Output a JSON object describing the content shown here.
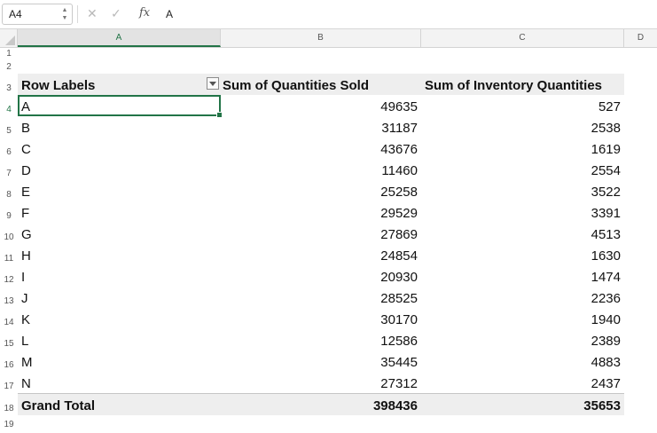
{
  "formula_bar": {
    "name_box": "A4",
    "cancel_icon": "✕",
    "enter_icon": "✓",
    "fx_label": "fx",
    "content": "A"
  },
  "columns": [
    "A",
    "B",
    "C",
    "D"
  ],
  "pivot": {
    "headers": {
      "row_labels": "Row Labels",
      "sum_sold": "Sum of Quantities Sold",
      "sum_inventory": "Sum of Inventory Quantities"
    },
    "rows": [
      {
        "label": "A",
        "sold": "49635",
        "inventory": "527"
      },
      {
        "label": "B",
        "sold": "31187",
        "inventory": "2538"
      },
      {
        "label": "C",
        "sold": "43676",
        "inventory": "1619"
      },
      {
        "label": "D",
        "sold": "11460",
        "inventory": "2554"
      },
      {
        "label": "E",
        "sold": "25258",
        "inventory": "3522"
      },
      {
        "label": "F",
        "sold": "29529",
        "inventory": "3391"
      },
      {
        "label": "G",
        "sold": "27869",
        "inventory": "4513"
      },
      {
        "label": "H",
        "sold": "24854",
        "inventory": "1630"
      },
      {
        "label": "I",
        "sold": "20930",
        "inventory": "1474"
      },
      {
        "label": "J",
        "sold": "28525",
        "inventory": "2236"
      },
      {
        "label": "K",
        "sold": "30170",
        "inventory": "1940"
      },
      {
        "label": "L",
        "sold": "12586",
        "inventory": "2389"
      },
      {
        "label": "M",
        "sold": "35445",
        "inventory": "4883"
      },
      {
        "label": "N",
        "sold": "27312",
        "inventory": "2437"
      }
    ],
    "grand_total": {
      "label": "Grand Total",
      "sold": "398436",
      "inventory": "35653"
    }
  },
  "row_numbers": [
    "1",
    "2",
    "3",
    "4",
    "5",
    "6",
    "7",
    "8",
    "9",
    "10",
    "11",
    "12",
    "13",
    "14",
    "15",
    "16",
    "17",
    "18",
    "19"
  ],
  "colors": {
    "accent": "#227447",
    "band": "#eeeeee"
  }
}
